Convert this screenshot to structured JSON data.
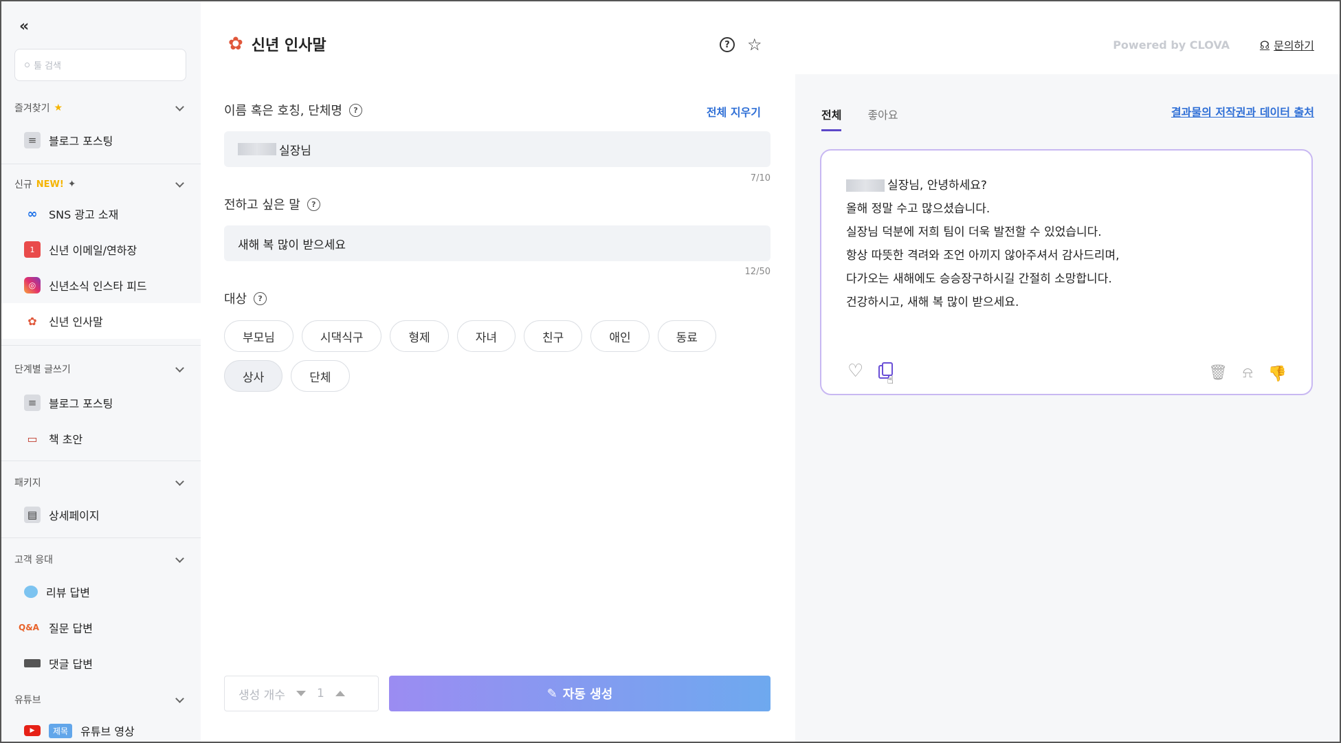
{
  "sidebar": {
    "collapse_icon": "«",
    "search_placeholder": "툴 검색",
    "sections": [
      {
        "title": "즐겨찾기",
        "items": [
          {
            "label": "블로그 포스팅",
            "icon": "blog-icon"
          }
        ]
      },
      {
        "title": "신규",
        "badge": "NEW!",
        "items": [
          {
            "label": "SNS 광고 소재",
            "icon": "meta-icon"
          },
          {
            "label": "신년 이메일/연하장",
            "icon": "calendar-icon"
          },
          {
            "label": "신년소식 인스타 피드",
            "icon": "instagram-icon"
          },
          {
            "label": "신년 인사말",
            "icon": "new-year-icon"
          }
        ]
      },
      {
        "title": "단계별 글쓰기",
        "items": [
          {
            "label": "블로그 포스팅",
            "icon": "blog-icon"
          },
          {
            "label": "책 초안",
            "icon": "book-icon"
          }
        ]
      },
      {
        "title": "패키지",
        "items": [
          {
            "label": "상세페이지",
            "icon": "detail-page-icon"
          }
        ]
      },
      {
        "title": "고객 응대",
        "items": [
          {
            "label": "리뷰 답변",
            "icon": "speech-bubble-icon"
          },
          {
            "label": "질문 답변",
            "icon": "qa-icon",
            "icon_text": "Q&A"
          },
          {
            "label": "댓글 답변",
            "icon": "keyboard-icon"
          }
        ]
      },
      {
        "title": "유튜브",
        "items": [
          {
            "label": "유튜브 영상",
            "icon": "youtube-icon",
            "tag": "제목"
          }
        ]
      }
    ]
  },
  "main": {
    "title": "신년 인사말",
    "clear_all": "전체 지우기",
    "name_label": "이름 혹은 호칭, 단체명",
    "name_value": "실장님",
    "name_count": "7/10",
    "message_label": "전하고 싶은 말",
    "message_value": "새해 복 많이 받으세요",
    "message_count": "12/50",
    "target_label": "대상",
    "targets": [
      "부모님",
      "시댁식구",
      "형제",
      "자녀",
      "친구",
      "애인",
      "동료",
      "상사",
      "단체"
    ],
    "selected_target": "상사",
    "gen_count_label": "생성 개수",
    "gen_count_value": "1",
    "generate_button": "자동 생성"
  },
  "right": {
    "powered_by": "Powered by CLOVA",
    "inquiry": "문의하기",
    "tabs": [
      "전체",
      "좋아요"
    ],
    "active_tab": "전체",
    "copyright_link": "결과물의 저작권과 데이터 출처",
    "result_lines": [
      "실장님, 안녕하세요?",
      "올해 정말 수고 많으셨습니다.",
      "실장님 덕분에 저희 팀이 더욱 발전할 수 있었습니다.",
      "항상 따뜻한 격려와 조언 아끼지 않아주셔서 감사드리며,",
      "다가오는 새해에도 승승장구하시길 간절히 소망합니다.",
      "건강하시고, 새해 복 많이 받으세요."
    ]
  },
  "colors": {
    "accent": "#5c48c9",
    "link": "#2f6fd6",
    "card_border": "#c8b8f2"
  }
}
